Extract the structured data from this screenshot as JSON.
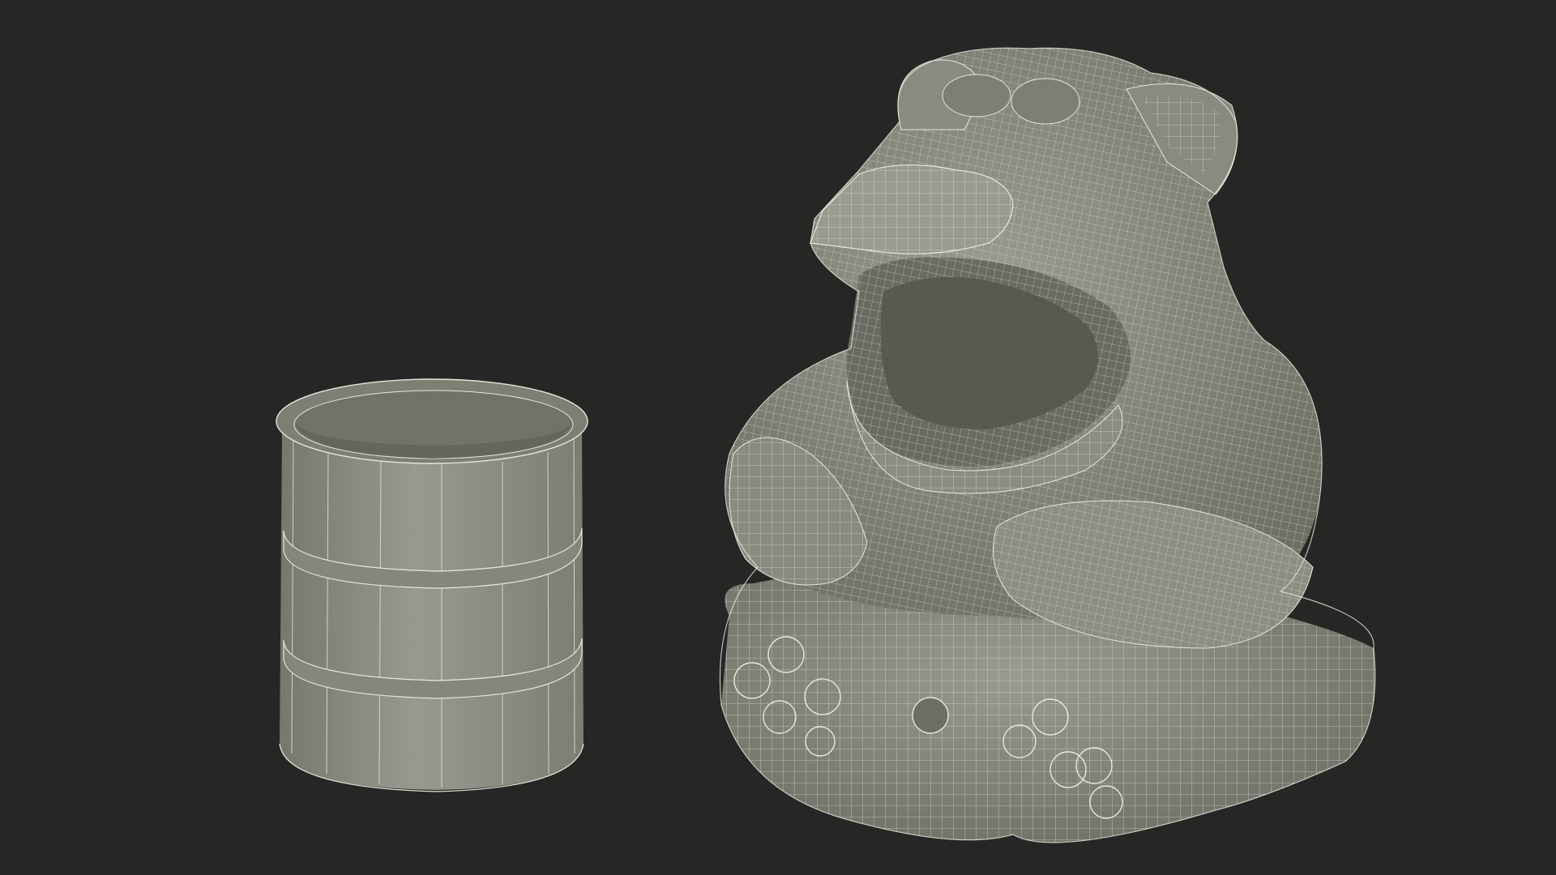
{
  "scene": {
    "description_free": true,
    "background_color": "#262625",
    "model_fill_color": "#8e8f84",
    "model_shadow_color": "#6f7066",
    "wire_color": "#e6e6dc",
    "objects": [
      {
        "kind": "barrel",
        "icon": "barrel-wireframe-icon"
      },
      {
        "kind": "bear-trash-bin",
        "icon": "bear-bin-wireframe-icon"
      }
    ]
  }
}
